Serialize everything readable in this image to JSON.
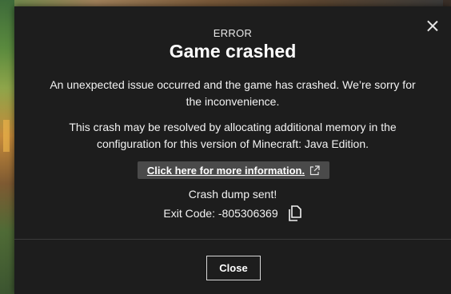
{
  "dialog": {
    "eyebrow": "ERROR",
    "title": "Game crashed",
    "message_1": "An unexpected issue occurred and the game has crashed. We’re sorry for the inconvenience.",
    "message_2": "This crash may be resolved by allocating additional memory in the configuration for this version of Minecraft: Java Edition.",
    "info_link_label": "Click here for more information.",
    "dump_status": "Crash dump sent!",
    "exit_code_text": "Exit Code: -805306369",
    "close_button_label": "Close"
  },
  "icons": {
    "close": "close-icon",
    "external_link": "external-link-icon",
    "copy": "copy-icon"
  },
  "colors": {
    "dialog_background": "#1d1d1d",
    "link_background": "#4a4a4a",
    "text": "#ffffff"
  }
}
